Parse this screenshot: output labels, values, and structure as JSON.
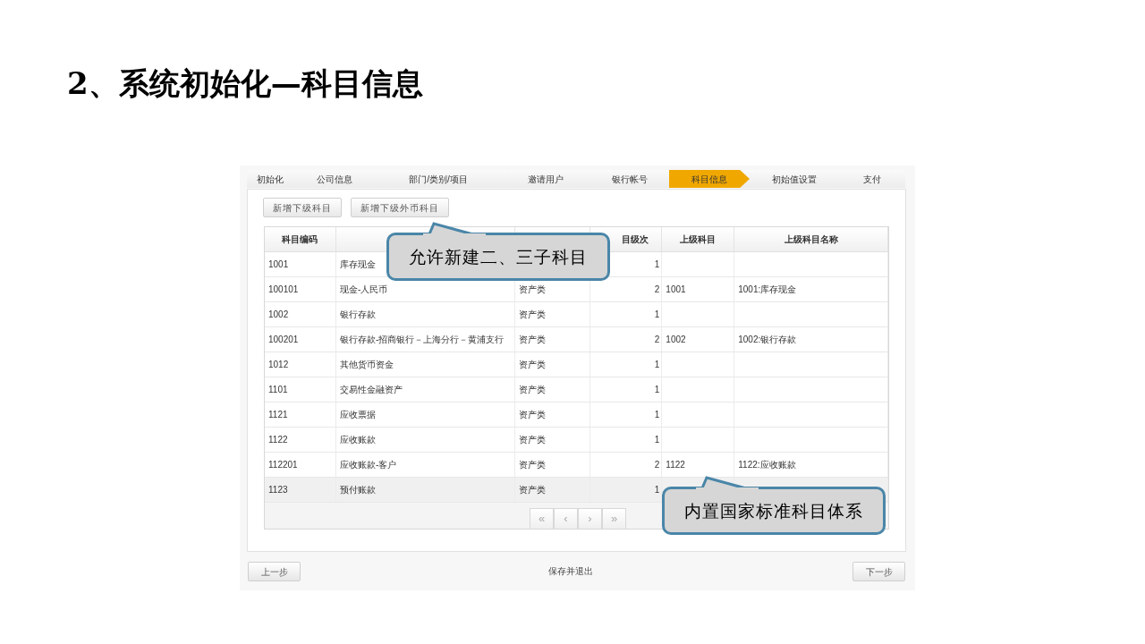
{
  "slide_title": "2、系统初始化—科目信息",
  "steps": [
    {
      "label": "初始化",
      "selected": false
    },
    {
      "label": "公司信息",
      "selected": false
    },
    {
      "label": "部门/类别/项目",
      "selected": false
    },
    {
      "label": "邀请用户",
      "selected": false
    },
    {
      "label": "银行帐号",
      "selected": false
    },
    {
      "label": "科目信息",
      "selected": true
    },
    {
      "label": "初始值设置",
      "selected": false
    },
    {
      "label": "支付",
      "selected": false
    }
  ],
  "toolbar_buttons": [
    "新增下级科目",
    "新增下级外币科目"
  ],
  "table": {
    "columns": [
      "科目编码",
      null,
      null,
      "目级次",
      "上级科目",
      "上级科目名称"
    ],
    "rows": [
      {
        "cells": [
          "1001",
          "库存现金",
          null,
          "1",
          null,
          null
        ],
        "selected": false
      },
      {
        "cells": [
          "100101",
          "现金-人民币",
          "资产类",
          "2",
          "1001",
          "1001:库存现金"
        ],
        "selected": false
      },
      {
        "cells": [
          "1002",
          "银行存款",
          "资产类",
          "1",
          null,
          null
        ],
        "selected": false
      },
      {
        "cells": [
          "100201",
          "银行存款-招商银行－上海分行－黄浦支行",
          "资产类",
          "2",
          "1002",
          "1002:银行存款"
        ],
        "selected": false
      },
      {
        "cells": [
          "1012",
          "其他货币资金",
          "资产类",
          "1",
          null,
          null
        ],
        "selected": false
      },
      {
        "cells": [
          "1101",
          "交易性金融资产",
          "资产类",
          "1",
          null,
          null
        ],
        "selected": false
      },
      {
        "cells": [
          "1121",
          "应收票据",
          "资产类",
          "1",
          null,
          null
        ],
        "selected": false
      },
      {
        "cells": [
          "1122",
          "应收账款",
          "资产类",
          "1",
          null,
          null
        ],
        "selected": false
      },
      {
        "cells": [
          "112201",
          "应收账款-客户",
          "资产类",
          "2",
          "1122",
          "1122:应收账款"
        ],
        "selected": false
      },
      {
        "cells": [
          "1123",
          "预付账款",
          "资产类",
          "1",
          null,
          null
        ],
        "selected": true
      }
    ]
  },
  "pagination": [
    "«",
    "‹",
    "›",
    "»"
  ],
  "footer": {
    "prev": "上一步",
    "save": "保存并退出",
    "next": "下一步"
  },
  "callouts": [
    "允许新建二、三子科目",
    "内置国家标准科目体系"
  ]
}
